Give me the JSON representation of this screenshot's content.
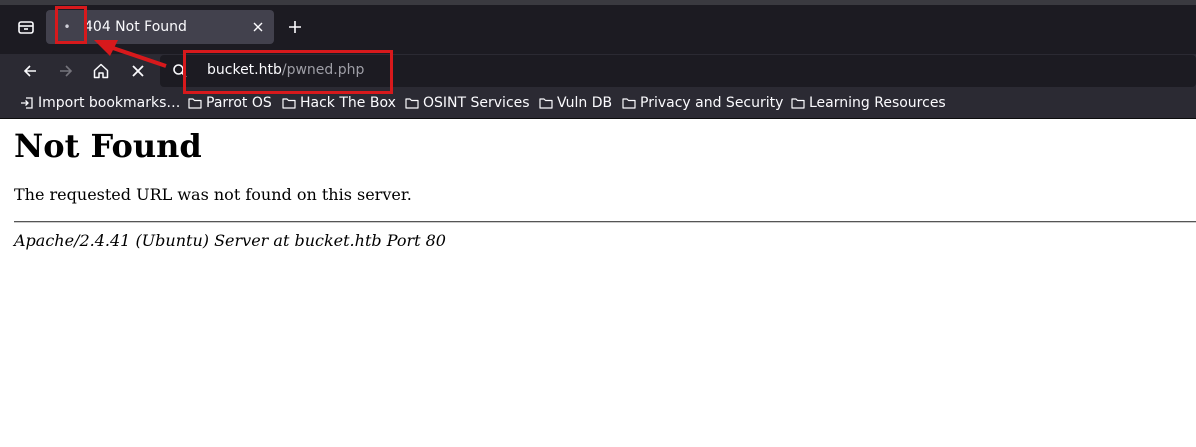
{
  "tab": {
    "title": "404 Not Found",
    "favicon": "•"
  },
  "url": {
    "host": "bucket.htb",
    "path": "/pwned.php"
  },
  "bookmarks": [
    {
      "label": "Import bookmarks…",
      "icon": "import-icon"
    },
    {
      "label": "Parrot OS",
      "icon": "folder-icon"
    },
    {
      "label": "Hack The Box",
      "icon": "folder-icon"
    },
    {
      "label": "OSINT Services",
      "icon": "folder-icon"
    },
    {
      "label": "Vuln DB",
      "icon": "folder-icon"
    },
    {
      "label": "Privacy and Security",
      "icon": "folder-icon"
    },
    {
      "label": "Learning Resources",
      "icon": "folder-icon"
    }
  ],
  "page": {
    "heading": "Not Found",
    "message": "The requested URL was not found on this server.",
    "address": "Apache/2.4.41 (Ubuntu) Server at bucket.htb Port 80"
  },
  "colors": {
    "chrome_dark": "#1c1b22",
    "chrome": "#2b2a33",
    "active_tab": "#42414d",
    "annotation_red": "#d7191c"
  }
}
